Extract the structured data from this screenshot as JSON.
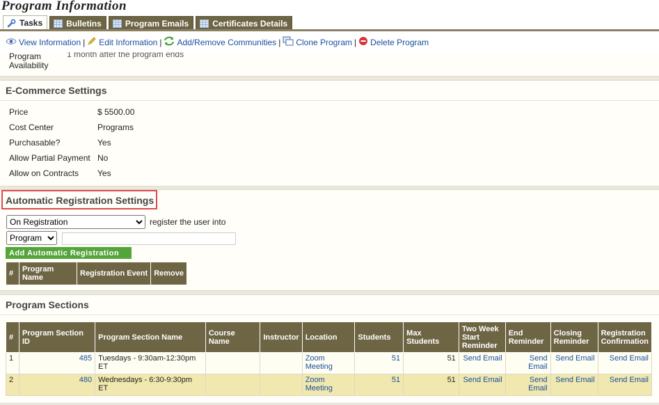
{
  "page": {
    "title": "Program Information"
  },
  "tabs": [
    {
      "label": "Tasks",
      "icon": "wrench-icon",
      "active": true
    },
    {
      "label": "Bulletins",
      "icon": "grid-icon",
      "active": false
    },
    {
      "label": "Program Emails",
      "icon": "grid-icon",
      "active": false
    },
    {
      "label": "Certificates Details",
      "icon": "grid-icon",
      "active": false
    }
  ],
  "actions": [
    {
      "label": "View Information",
      "icon": "eye-icon"
    },
    {
      "label": "Edit Information",
      "icon": "pencil-icon"
    },
    {
      "label": "Add/Remove Communities",
      "icon": "refresh-icon"
    },
    {
      "label": "Clone Program",
      "icon": "clone-icon"
    },
    {
      "label": "Delete Program",
      "icon": "delete-icon"
    }
  ],
  "availability": {
    "label_line1": "Program",
    "label_line2": "Availability",
    "value": "1 month after the program ends"
  },
  "ecommerce": {
    "title": "E-Commerce Settings",
    "rows": [
      {
        "label": "Price",
        "value": "$ 5500.00"
      },
      {
        "label": "Cost Center",
        "value": "Programs"
      },
      {
        "label": "Purchasable?",
        "value": "Yes"
      },
      {
        "label": "Allow Partial Payment",
        "value": "No"
      },
      {
        "label": "Allow on Contracts",
        "value": "Yes"
      }
    ]
  },
  "auto_reg": {
    "title": "Automatic Registration Settings",
    "event_select": "On Registration",
    "register_text": "register the user into",
    "type_select": "Program",
    "program_input": "",
    "add_button": "Add Automatic Registration",
    "headers": [
      "#",
      "Program Name",
      "Registration Event",
      "Remove"
    ]
  },
  "sections": {
    "title": "Program Sections",
    "headers": [
      "#",
      "Program Section ID",
      "Program Section Name",
      "Course Name",
      "Instructor",
      "Location",
      "Students",
      "Max Students",
      "Two Week Start Reminder",
      "End Reminder",
      "Closing Reminder",
      "Registration Confirmation"
    ],
    "rows": [
      {
        "num": "1",
        "id": "485",
        "name": "Tuesdays - 9:30am-12:30pm ET",
        "course": "",
        "instructor": "",
        "location": "Zoom Meeting",
        "students": "51",
        "max": "51",
        "two_week": "Send Email",
        "end": "Send Email",
        "closing": "Send Email",
        "confirm": "Send Email"
      },
      {
        "num": "2",
        "id": "480",
        "name": "Wednesdays - 6:30-9:30pm ET",
        "course": "",
        "instructor": "",
        "location": "Zoom Meeting",
        "students": "51",
        "max": "51",
        "two_week": "Send Email",
        "end": "Send Email",
        "closing": "Send Email",
        "confirm": "Send Email"
      }
    ]
  }
}
